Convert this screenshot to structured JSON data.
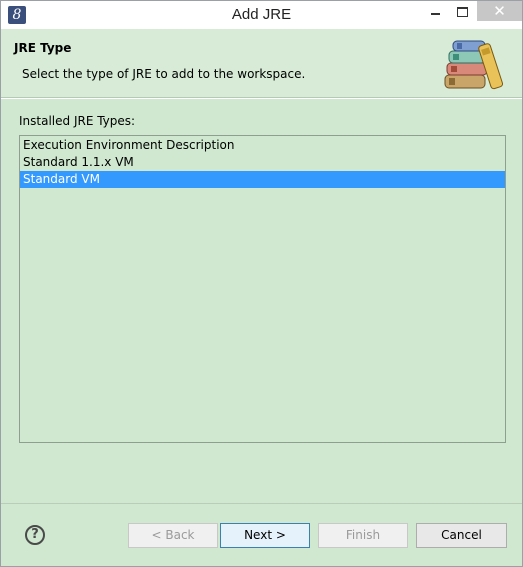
{
  "window": {
    "title": "Add JRE",
    "app_icon": "eclipse-icon",
    "close_glyph": "✕"
  },
  "header": {
    "title": "JRE Type",
    "description": "Select the type of JRE to add to the workspace.",
    "image": "books-icon"
  },
  "list": {
    "label": "Installed JRE Types:",
    "items": [
      {
        "label": "Execution Environment Description"
      },
      {
        "label": "Standard 1.1.x VM"
      },
      {
        "label": "Standard VM",
        "selected": true
      }
    ]
  },
  "buttons": {
    "help": "?",
    "back": "< Back",
    "next": "Next >",
    "finish": "Finish",
    "cancel": "Cancel"
  },
  "colors": {
    "selection": "#3399ff",
    "background": "#cfe8cf"
  }
}
